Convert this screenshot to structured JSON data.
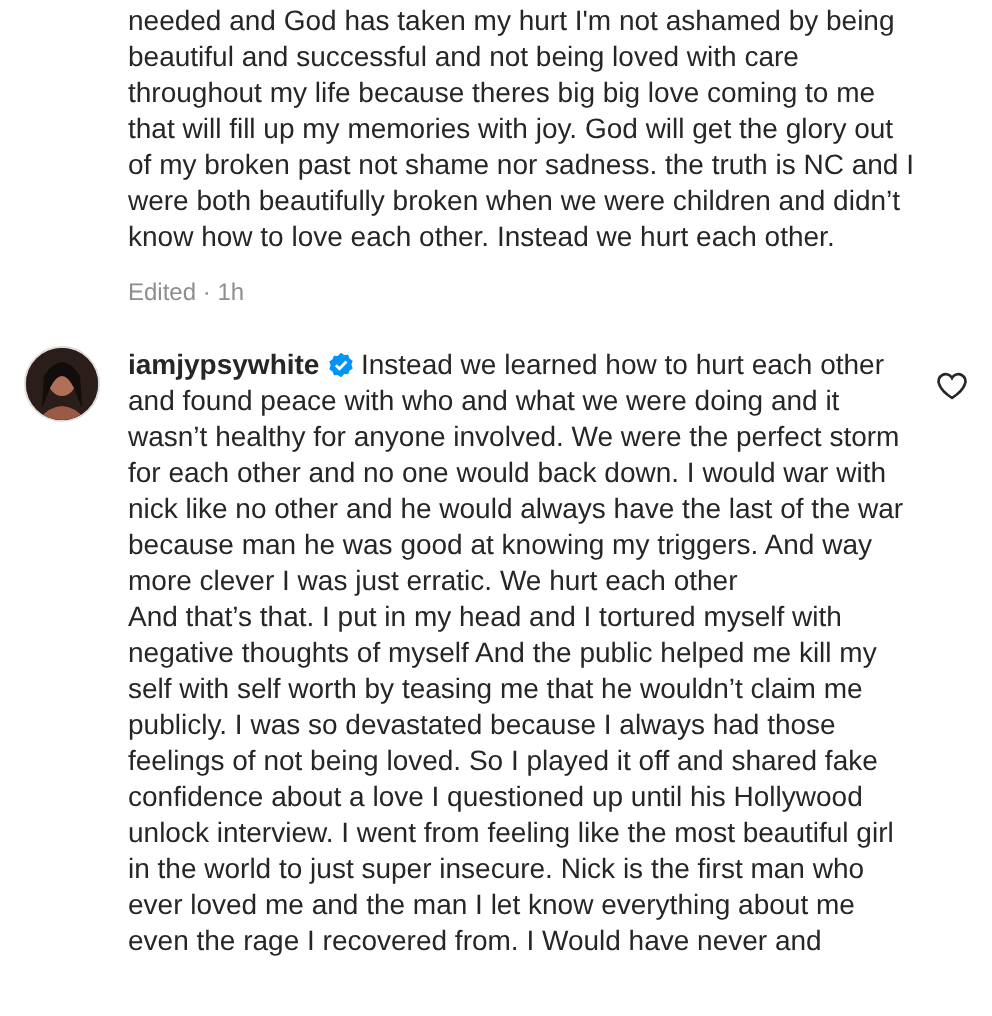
{
  "comments": [
    {
      "kind": "continued",
      "paragraphs": [
        "needed and God has taken my hurt I'm not ashamed by being beautiful and successful and not being loved with care throughout my life because theres big big love coming to me that will fill up my memories with joy. God will get the glory out of my broken past not shame nor sadness. the truth is NC and I were both beautifully broken when we were children and didn’t know how to love each other. Instead we hurt each other."
      ],
      "meta": "Edited · 1h"
    },
    {
      "kind": "verified",
      "username": "iamjypsywhite",
      "paragraphs": [
        "Instead we learned how to hurt each other and found peace with who and what we were doing and it wasn’t healthy for anyone involved. We were the perfect storm for each other and no one would back down. I would war with nick like no other and he would always have the last of the war because man he was good at knowing my triggers. And way more clever I was just erratic. We hurt each other",
        "And that’s that. I put in my head and I tortured myself with negative thoughts of myself And the public helped me kill my self with self worth by teasing me that he wouldn’t claim me publicly. I was so devastated because I always had those feelings of not being loved. So I played it off and shared fake confidence about a love I questioned up until his Hollywood unlock interview. I went from feeling like the most beautiful girl in the world to just super insecure. Nick is the first man who ever loved me and the man I let know everything about me even the rage I recovered from. I Would have never and"
      ]
    }
  ]
}
